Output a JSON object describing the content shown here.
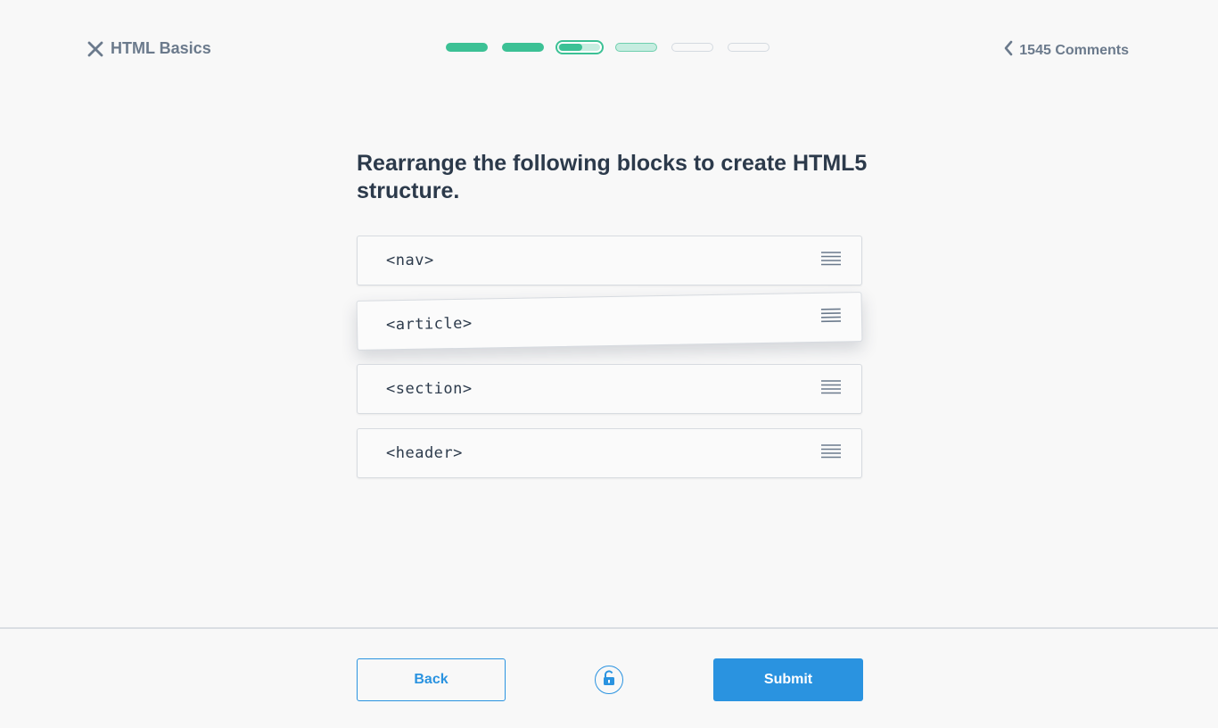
{
  "header": {
    "close_icon": "close-icon",
    "lesson_title": "HTML Basics",
    "comments_icon": "chevron-left-icon",
    "comments_label": "1545 Comments"
  },
  "progress": {
    "total_steps": 6,
    "completed_steps": 2,
    "current_step": 3,
    "current_step_fill": 0.5,
    "colors": {
      "done": "#3cc195",
      "upcoming": "#c6ede0",
      "empty": "#d4dae0"
    }
  },
  "question": {
    "text": "Rearrange the following blocks to create HTML5 structure."
  },
  "blocks": [
    {
      "code": "<nav>",
      "handle_icon": "drag-handle-icon"
    },
    {
      "code": "<article>",
      "handle_icon": "drag-handle-icon",
      "state": "dragging"
    },
    {
      "code": "<section>",
      "handle_icon": "drag-handle-icon"
    },
    {
      "code": "<header>",
      "handle_icon": "drag-handle-icon"
    }
  ],
  "footer": {
    "back_label": "Back",
    "unlock_icon": "unlock-icon",
    "submit_label": "Submit",
    "accent_color": "#2a93e0"
  }
}
